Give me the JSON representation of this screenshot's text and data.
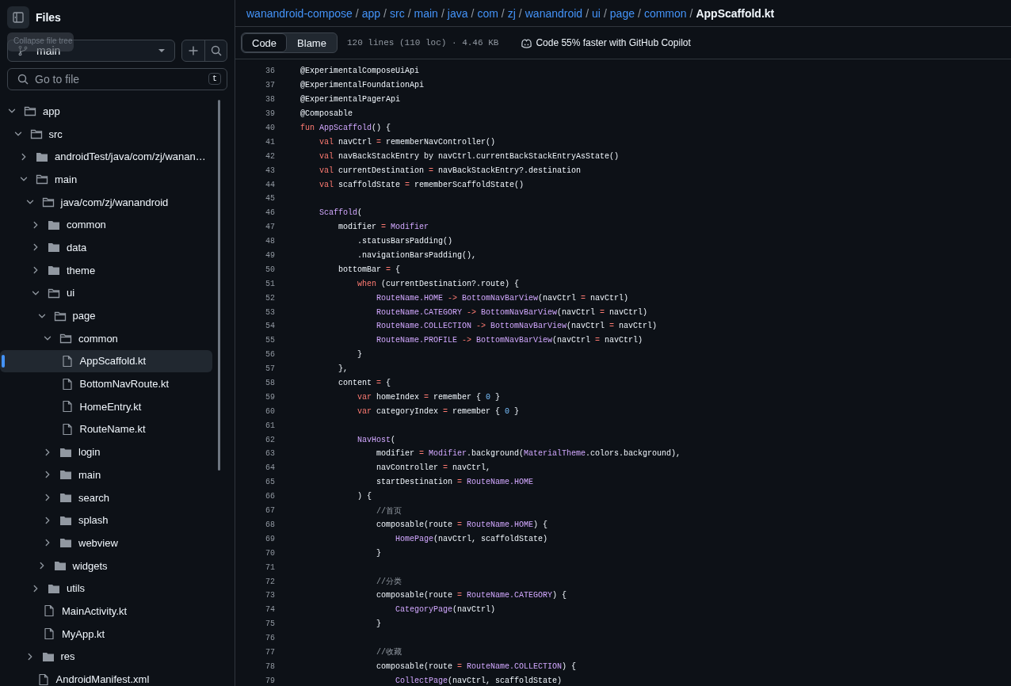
{
  "sidebar": {
    "title": "Files",
    "tooltip": "Collapse file tree",
    "branch": "main",
    "search": {
      "placeholder": "Go to file",
      "shortcut": "t"
    },
    "tree": [
      {
        "kind": "folder",
        "name": "app",
        "expanded": true,
        "selected": false,
        "children": [
          {
            "kind": "folder",
            "name": "src",
            "expanded": true,
            "selected": false,
            "children": [
              {
                "kind": "folder",
                "name": "androidTest/java/com/zj/wanan…",
                "expanded": false,
                "selected": false
              },
              {
                "kind": "folder",
                "name": "main",
                "expanded": true,
                "selected": false,
                "children": [
                  {
                    "kind": "folder",
                    "name": "java/com/zj/wanandroid",
                    "expanded": true,
                    "selected": false,
                    "children": [
                      {
                        "kind": "folder",
                        "name": "common",
                        "expanded": false,
                        "selected": false
                      },
                      {
                        "kind": "folder",
                        "name": "data",
                        "expanded": false,
                        "selected": false
                      },
                      {
                        "kind": "folder",
                        "name": "theme",
                        "expanded": false,
                        "selected": false
                      },
                      {
                        "kind": "folder",
                        "name": "ui",
                        "expanded": true,
                        "selected": false,
                        "children": [
                          {
                            "kind": "folder",
                            "name": "page",
                            "expanded": true,
                            "selected": false,
                            "children": [
                              {
                                "kind": "folder",
                                "name": "common",
                                "expanded": true,
                                "selected": false,
                                "children": [
                                  {
                                    "kind": "file",
                                    "name": "AppScaffold.kt",
                                    "selected": true
                                  },
                                  {
                                    "kind": "file",
                                    "name": "BottomNavRoute.kt",
                                    "selected": false
                                  },
                                  {
                                    "kind": "file",
                                    "name": "HomeEntry.kt",
                                    "selected": false
                                  },
                                  {
                                    "kind": "file",
                                    "name": "RouteName.kt",
                                    "selected": false
                                  }
                                ]
                              },
                              {
                                "kind": "folder",
                                "name": "login",
                                "expanded": false,
                                "selected": false
                              },
                              {
                                "kind": "folder",
                                "name": "main",
                                "expanded": false,
                                "selected": false
                              },
                              {
                                "kind": "folder",
                                "name": "search",
                                "expanded": false,
                                "selected": false
                              },
                              {
                                "kind": "folder",
                                "name": "splash",
                                "expanded": false,
                                "selected": false
                              },
                              {
                                "kind": "folder",
                                "name": "webview",
                                "expanded": false,
                                "selected": false
                              }
                            ]
                          },
                          {
                            "kind": "folder",
                            "name": "widgets",
                            "expanded": false,
                            "selected": false
                          }
                        ]
                      },
                      {
                        "kind": "folder",
                        "name": "utils",
                        "expanded": false,
                        "selected": false
                      },
                      {
                        "kind": "file",
                        "name": "MainActivity.kt",
                        "selected": false
                      },
                      {
                        "kind": "file",
                        "name": "MyApp.kt",
                        "selected": false
                      }
                    ]
                  },
                  {
                    "kind": "folder",
                    "name": "res",
                    "expanded": false,
                    "selected": false
                  },
                  {
                    "kind": "file",
                    "name": "AndroidManifest.xml",
                    "selected": false
                  }
                ]
              }
            ]
          }
        ]
      }
    ]
  },
  "breadcrumb": [
    {
      "kind": "link",
      "text": "wanandroid-compose"
    },
    {
      "kind": "separator",
      "text": "/"
    },
    {
      "kind": "link",
      "text": "app"
    },
    {
      "kind": "separator",
      "text": "/"
    },
    {
      "kind": "link",
      "text": "src"
    },
    {
      "kind": "separator",
      "text": "/"
    },
    {
      "kind": "link",
      "text": "main"
    },
    {
      "kind": "separator",
      "text": "/"
    },
    {
      "kind": "link",
      "text": "java"
    },
    {
      "kind": "separator",
      "text": "/"
    },
    {
      "kind": "link",
      "text": "com"
    },
    {
      "kind": "separator",
      "text": "/"
    },
    {
      "kind": "link",
      "text": "zj"
    },
    {
      "kind": "separator",
      "text": "/"
    },
    {
      "kind": "link",
      "text": "wanandroid"
    },
    {
      "kind": "separator",
      "text": "/"
    },
    {
      "kind": "link",
      "text": "ui"
    },
    {
      "kind": "separator",
      "text": "/"
    },
    {
      "kind": "link",
      "text": "page"
    },
    {
      "kind": "separator",
      "text": "/"
    },
    {
      "kind": "link",
      "text": "common"
    },
    {
      "kind": "separator",
      "text": "/"
    },
    {
      "kind": "current",
      "text": "AppScaffold.kt"
    }
  ],
  "toolbar": {
    "tabs": [
      {
        "label": "Code",
        "selected": true
      },
      {
        "label": "Blame",
        "selected": false
      }
    ],
    "file_info": "120 lines (110 loc) · 4.46 KB",
    "copilot": "Code 55% faster with GitHub Copilot"
  },
  "code": [
    {
      "number": "36",
      "tokens": [
        {
          "kind": "plain",
          "text": "@ExperimentalComposeUiApi"
        }
      ]
    },
    {
      "number": "37",
      "tokens": [
        {
          "kind": "plain",
          "text": "@ExperimentalFoundationApi"
        }
      ]
    },
    {
      "number": "38",
      "tokens": [
        {
          "kind": "plain",
          "text": "@ExperimentalPagerApi"
        }
      ]
    },
    {
      "number": "39",
      "tokens": [
        {
          "kind": "plain",
          "text": "@Composable"
        }
      ]
    },
    {
      "number": "40",
      "tokens": [
        {
          "kind": "keyword",
          "text": "fun "
        },
        {
          "kind": "entity",
          "text": "AppScaffold"
        },
        {
          "kind": "plain",
          "text": "() {"
        }
      ]
    },
    {
      "number": "41",
      "tokens": [
        {
          "kind": "keyword",
          "text": "    val"
        },
        {
          "kind": "plain",
          "text": " navCtrl "
        },
        {
          "kind": "keyword",
          "text": "="
        },
        {
          "kind": "plain",
          "text": " rememberNavController()"
        }
      ]
    },
    {
      "number": "42",
      "tokens": [
        {
          "kind": "keyword",
          "text": "    val"
        },
        {
          "kind": "plain",
          "text": " navBackStackEntry by navCtrl.currentBackStackEntryAsState()"
        }
      ]
    },
    {
      "number": "43",
      "tokens": [
        {
          "kind": "keyword",
          "text": "    val"
        },
        {
          "kind": "plain",
          "text": " currentDestination "
        },
        {
          "kind": "keyword",
          "text": "="
        },
        {
          "kind": "plain",
          "text": " navBackStackEntry?.destination"
        }
      ]
    },
    {
      "number": "44",
      "tokens": [
        {
          "kind": "keyword",
          "text": "    val"
        },
        {
          "kind": "plain",
          "text": " scaffoldState "
        },
        {
          "kind": "keyword",
          "text": "="
        },
        {
          "kind": "plain",
          "text": " rememberScaffoldState()"
        }
      ]
    },
    {
      "number": "45"
    },
    {
      "number": "46",
      "tokens": [
        {
          "kind": "entity",
          "text": "    Scaffold"
        },
        {
          "kind": "plain",
          "text": "("
        }
      ]
    },
    {
      "number": "47",
      "tokens": [
        {
          "kind": "plain",
          "text": "        modifier "
        },
        {
          "kind": "keyword",
          "text": "= "
        },
        {
          "kind": "entity",
          "text": "Modifier"
        }
      ]
    },
    {
      "number": "48",
      "tokens": [
        {
          "kind": "plain",
          "text": "            .statusBarsPadding()"
        }
      ]
    },
    {
      "number": "49",
      "tokens": [
        {
          "kind": "plain",
          "text": "            .navigationBarsPadding(),"
        }
      ]
    },
    {
      "number": "50",
      "tokens": [
        {
          "kind": "plain",
          "text": "        bottomBar "
        },
        {
          "kind": "keyword",
          "text": "="
        },
        {
          "kind": "plain",
          "text": " {"
        }
      ]
    },
    {
      "number": "51",
      "tokens": [
        {
          "kind": "keyword",
          "text": "            when"
        },
        {
          "kind": "plain",
          "text": " (currentDestination?.route) {"
        }
      ]
    },
    {
      "number": "52",
      "tokens": [
        {
          "kind": "entity",
          "text": "                RouteName.HOME "
        },
        {
          "kind": "keyword",
          "text": "-> "
        },
        {
          "kind": "entity",
          "text": "BottomNavBarView"
        },
        {
          "kind": "plain",
          "text": "(navCtrl "
        },
        {
          "kind": "keyword",
          "text": "="
        },
        {
          "kind": "plain",
          "text": " navCtrl)"
        }
      ]
    },
    {
      "number": "53",
      "tokens": [
        {
          "kind": "entity",
          "text": "                RouteName.CATEGORY "
        },
        {
          "kind": "keyword",
          "text": "-> "
        },
        {
          "kind": "entity",
          "text": "BottomNavBarView"
        },
        {
          "kind": "plain",
          "text": "(navCtrl "
        },
        {
          "kind": "keyword",
          "text": "="
        },
        {
          "kind": "plain",
          "text": " navCtrl)"
        }
      ]
    },
    {
      "number": "54",
      "tokens": [
        {
          "kind": "entity",
          "text": "                RouteName.COLLECTION "
        },
        {
          "kind": "keyword",
          "text": "-> "
        },
        {
          "kind": "entity",
          "text": "BottomNavBarView"
        },
        {
          "kind": "plain",
          "text": "(navCtrl "
        },
        {
          "kind": "keyword",
          "text": "="
        },
        {
          "kind": "plain",
          "text": " navCtrl)"
        }
      ]
    },
    {
      "number": "55",
      "tokens": [
        {
          "kind": "entity",
          "text": "                RouteName.PROFILE "
        },
        {
          "kind": "keyword",
          "text": "-> "
        },
        {
          "kind": "entity",
          "text": "BottomNavBarView"
        },
        {
          "kind": "plain",
          "text": "(navCtrl "
        },
        {
          "kind": "keyword",
          "text": "="
        },
        {
          "kind": "plain",
          "text": " navCtrl)"
        }
      ]
    },
    {
      "number": "56",
      "tokens": [
        {
          "kind": "plain",
          "text": "            }"
        }
      ]
    },
    {
      "number": "57",
      "tokens": [
        {
          "kind": "plain",
          "text": "        },"
        }
      ]
    },
    {
      "number": "58",
      "tokens": [
        {
          "kind": "plain",
          "text": "        content "
        },
        {
          "kind": "keyword",
          "text": "="
        },
        {
          "kind": "plain",
          "text": " {"
        }
      ]
    },
    {
      "number": "59",
      "tokens": [
        {
          "kind": "keyword",
          "text": "            var"
        },
        {
          "kind": "plain",
          "text": " homeIndex "
        },
        {
          "kind": "keyword",
          "text": "="
        },
        {
          "kind": "plain",
          "text": " remember { "
        },
        {
          "kind": "number",
          "text": "0"
        },
        {
          "kind": "plain",
          "text": " }"
        }
      ]
    },
    {
      "number": "60",
      "tokens": [
        {
          "kind": "keyword",
          "text": "            var"
        },
        {
          "kind": "plain",
          "text": " categoryIndex "
        },
        {
          "kind": "keyword",
          "text": "="
        },
        {
          "kind": "plain",
          "text": " remember { "
        },
        {
          "kind": "number",
          "text": "0"
        },
        {
          "kind": "plain",
          "text": " }"
        }
      ]
    },
    {
      "number": "61"
    },
    {
      "number": "62",
      "tokens": [
        {
          "kind": "entity",
          "text": "            NavHost"
        },
        {
          "kind": "plain",
          "text": "("
        }
      ]
    },
    {
      "number": "63",
      "tokens": [
        {
          "kind": "plain",
          "text": "                modifier "
        },
        {
          "kind": "keyword",
          "text": "= "
        },
        {
          "kind": "entity",
          "text": "Modifier"
        },
        {
          "kind": "plain",
          "text": ".background("
        },
        {
          "kind": "entity",
          "text": "MaterialTheme"
        },
        {
          "kind": "plain",
          "text": ".colors.background),"
        }
      ]
    },
    {
      "number": "64",
      "tokens": [
        {
          "kind": "plain",
          "text": "                navController "
        },
        {
          "kind": "keyword",
          "text": "="
        },
        {
          "kind": "plain",
          "text": " navCtrl,"
        }
      ]
    },
    {
      "number": "65",
      "tokens": [
        {
          "kind": "plain",
          "text": "                startDestination "
        },
        {
          "kind": "keyword",
          "text": "= "
        },
        {
          "kind": "entity",
          "text": "RouteName.HOME"
        }
      ]
    },
    {
      "number": "66",
      "tokens": [
        {
          "kind": "plain",
          "text": "            ) {"
        }
      ]
    },
    {
      "number": "67",
      "tokens": [
        {
          "kind": "comment",
          "text": "                //首页"
        }
      ]
    },
    {
      "number": "68",
      "tokens": [
        {
          "kind": "plain",
          "text": "                composable(route "
        },
        {
          "kind": "keyword",
          "text": "= "
        },
        {
          "kind": "entity",
          "text": "RouteName.HOME"
        },
        {
          "kind": "plain",
          "text": ") {"
        }
      ]
    },
    {
      "number": "69",
      "tokens": [
        {
          "kind": "entity",
          "text": "                    HomePage"
        },
        {
          "kind": "plain",
          "text": "(navCtrl, scaffoldState)"
        }
      ]
    },
    {
      "number": "70",
      "tokens": [
        {
          "kind": "plain",
          "text": "                }"
        }
      ]
    },
    {
      "number": "71"
    },
    {
      "number": "72",
      "tokens": [
        {
          "kind": "comment",
          "text": "                //分类"
        }
      ]
    },
    {
      "number": "73",
      "tokens": [
        {
          "kind": "plain",
          "text": "                composable(route "
        },
        {
          "kind": "keyword",
          "text": "= "
        },
        {
          "kind": "entity",
          "text": "RouteName.CATEGORY"
        },
        {
          "kind": "plain",
          "text": ") {"
        }
      ]
    },
    {
      "number": "74",
      "tokens": [
        {
          "kind": "entity",
          "text": "                    CategoryPage"
        },
        {
          "kind": "plain",
          "text": "(navCtrl)"
        }
      ]
    },
    {
      "number": "75",
      "tokens": [
        {
          "kind": "plain",
          "text": "                }"
        }
      ]
    },
    {
      "number": "76"
    },
    {
      "number": "77",
      "tokens": [
        {
          "kind": "comment",
          "text": "                //收藏"
        }
      ]
    },
    {
      "number": "78",
      "tokens": [
        {
          "kind": "plain",
          "text": "                composable(route "
        },
        {
          "kind": "keyword",
          "text": "= "
        },
        {
          "kind": "entity",
          "text": "RouteName.COLLECTION"
        },
        {
          "kind": "plain",
          "text": ") {"
        }
      ]
    },
    {
      "number": "79",
      "tokens": [
        {
          "kind": "entity",
          "text": "                    CollectPage"
        },
        {
          "kind": "plain",
          "text": "(navCtrl, scaffoldState)"
        }
      ]
    }
  ]
}
